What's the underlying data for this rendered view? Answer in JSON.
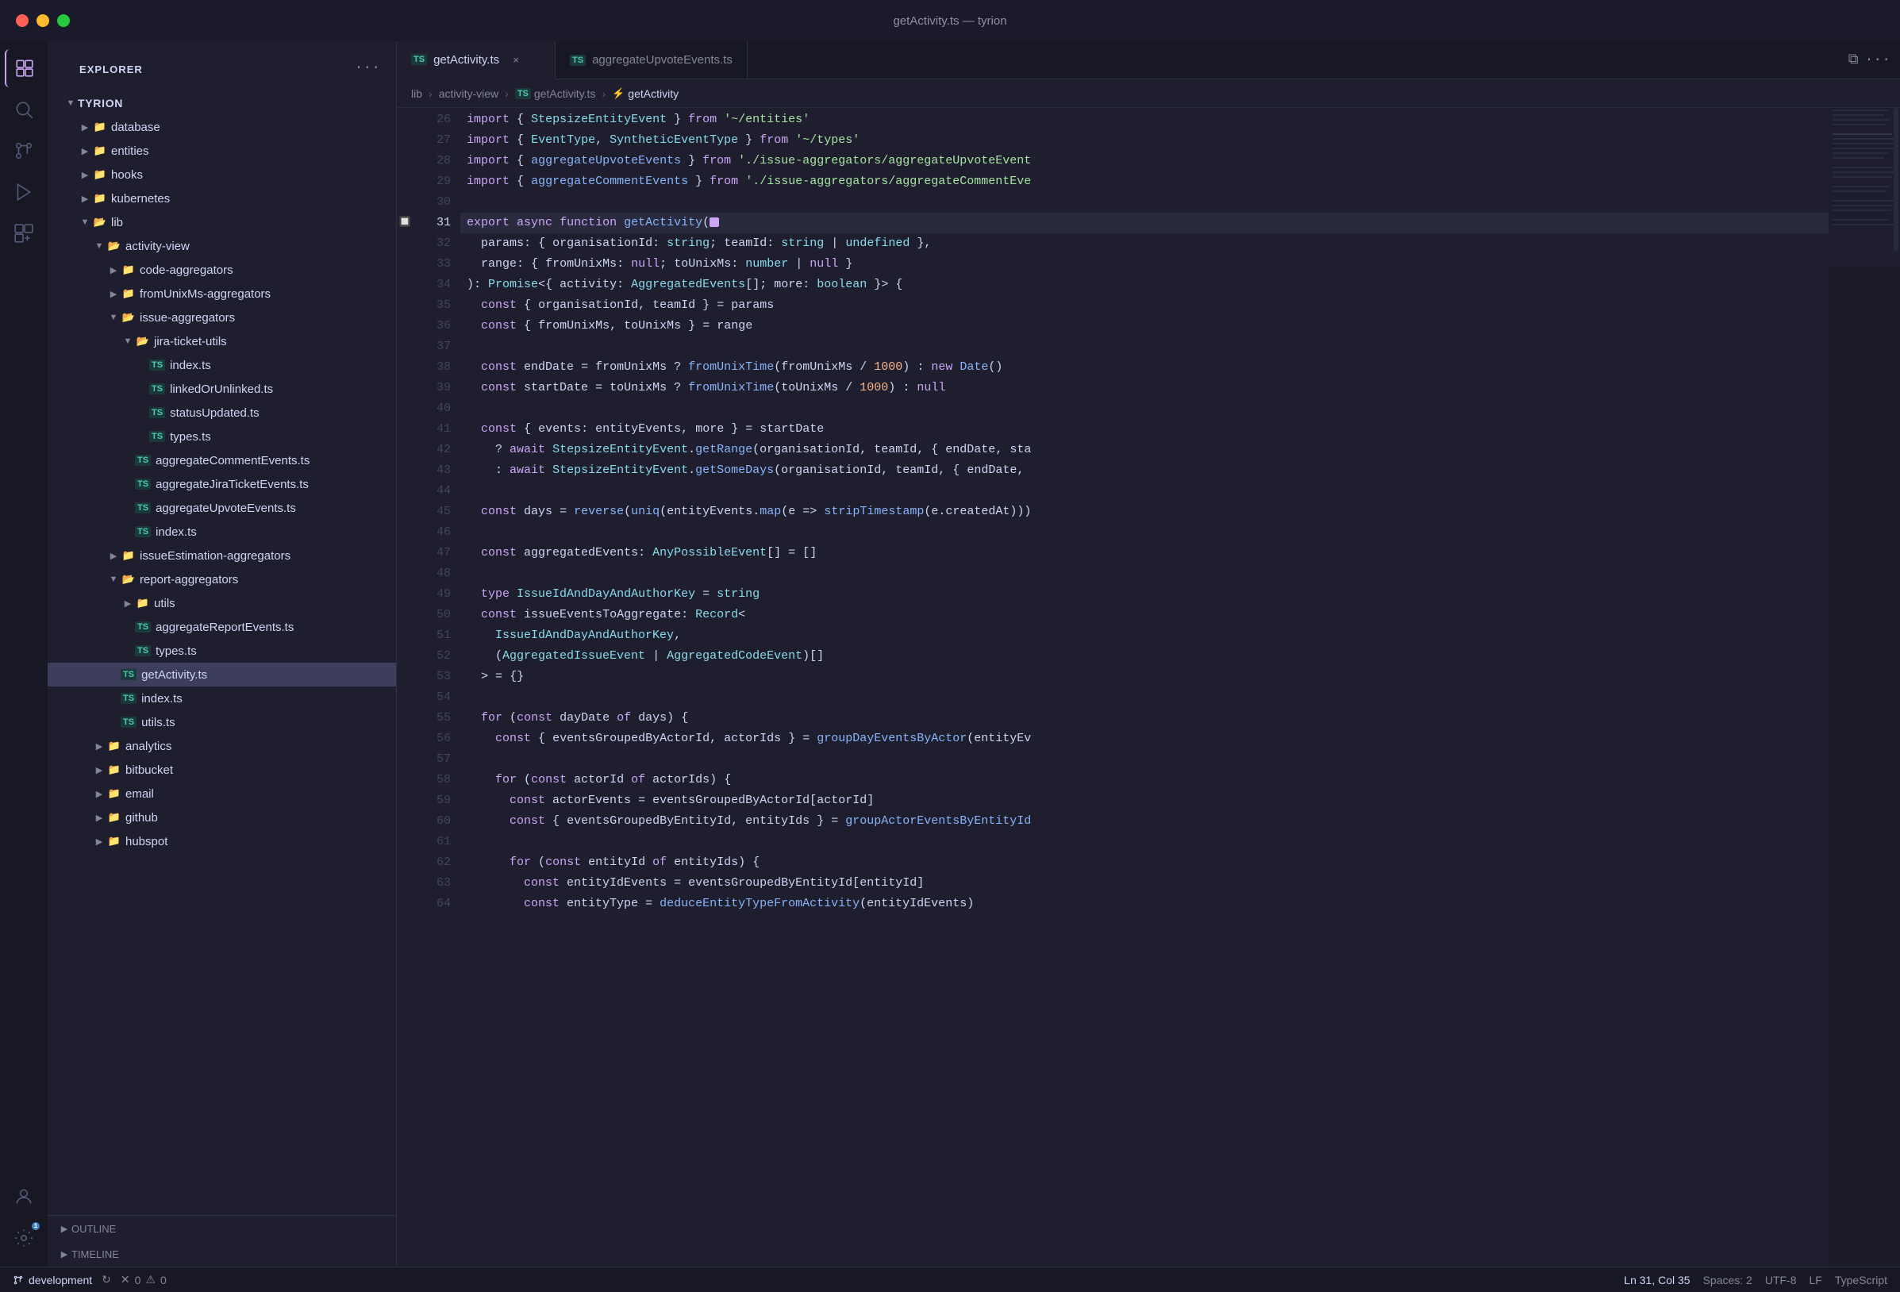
{
  "titlebar": {
    "title": "getActivity.ts — tyrion"
  },
  "tabs": [
    {
      "id": "getActivity",
      "label": "getActivity.ts",
      "icon": "TS",
      "active": true,
      "closeable": true
    },
    {
      "id": "aggregateUpvoteEvents",
      "label": "aggregateUpvoteEvents.ts",
      "icon": "TS",
      "active": false,
      "closeable": false
    }
  ],
  "breadcrumb": {
    "items": [
      "lib",
      "activity-view",
      "getActivity.ts",
      "getActivity"
    ]
  },
  "sidebar": {
    "header": "EXPLORER",
    "tree": [
      {
        "id": "tyrion",
        "label": "TYRION",
        "level": 0,
        "type": "root",
        "expanded": true
      },
      {
        "id": "database",
        "label": "database",
        "level": 1,
        "type": "folder",
        "expanded": false
      },
      {
        "id": "entities",
        "label": "entities",
        "level": 1,
        "type": "folder",
        "expanded": false
      },
      {
        "id": "hooks",
        "label": "hooks",
        "level": 1,
        "type": "folder",
        "expanded": false
      },
      {
        "id": "kubernetes",
        "label": "kubernetes",
        "level": 1,
        "type": "folder",
        "expanded": false
      },
      {
        "id": "lib",
        "label": "lib",
        "level": 1,
        "type": "folder",
        "expanded": true
      },
      {
        "id": "activity-view",
        "label": "activity-view",
        "level": 2,
        "type": "folder",
        "expanded": true
      },
      {
        "id": "code-aggregators",
        "label": "code-aggregators",
        "level": 3,
        "type": "folder",
        "expanded": false
      },
      {
        "id": "fromUnixMs-aggregators",
        "label": "fromUnixMs-aggregators",
        "level": 3,
        "type": "folder",
        "expanded": false
      },
      {
        "id": "issue-aggregators",
        "label": "issue-aggregators",
        "level": 3,
        "type": "folder",
        "expanded": true
      },
      {
        "id": "jira-ticket-utils",
        "label": "jira-ticket-utils",
        "level": 4,
        "type": "folder",
        "expanded": true
      },
      {
        "id": "index.ts-jira",
        "label": "index.ts",
        "level": 5,
        "type": "ts"
      },
      {
        "id": "linkedOrUnlinked.ts",
        "label": "linkedOrUnlinked.ts",
        "level": 5,
        "type": "ts"
      },
      {
        "id": "statusUpdated.ts",
        "label": "statusUpdated.ts",
        "level": 5,
        "type": "ts"
      },
      {
        "id": "types.ts-jira",
        "label": "types.ts",
        "level": 5,
        "type": "ts"
      },
      {
        "id": "aggregateCommentEvents.ts",
        "label": "aggregateCommentEvents.ts",
        "level": 4,
        "type": "ts"
      },
      {
        "id": "aggregateJiraTicketEvents.ts",
        "label": "aggregateJiraTicketEvents.ts",
        "level": 4,
        "type": "ts"
      },
      {
        "id": "aggregateUpvoteEvents.ts",
        "label": "aggregateUpvoteEvents.ts",
        "level": 4,
        "type": "ts"
      },
      {
        "id": "index.ts-issue",
        "label": "index.ts",
        "level": 4,
        "type": "ts"
      },
      {
        "id": "issueEstimation-aggregators",
        "label": "issueEstimation-aggregators",
        "level": 3,
        "type": "folder",
        "expanded": false
      },
      {
        "id": "report-aggregators",
        "label": "report-aggregators",
        "level": 3,
        "type": "folder",
        "expanded": true
      },
      {
        "id": "utils",
        "label": "utils",
        "level": 4,
        "type": "folder",
        "expanded": false
      },
      {
        "id": "aggregateReportEvents.ts",
        "label": "aggregateReportEvents.ts",
        "level": 4,
        "type": "ts"
      },
      {
        "id": "types.ts-report",
        "label": "types.ts",
        "level": 4,
        "type": "ts"
      },
      {
        "id": "getActivity.ts",
        "label": "getActivity.ts",
        "level": 3,
        "type": "ts",
        "selected": true
      },
      {
        "id": "index.ts-lib",
        "label": "index.ts",
        "level": 3,
        "type": "ts"
      },
      {
        "id": "utils.ts",
        "label": "utils.ts",
        "level": 3,
        "type": "ts"
      },
      {
        "id": "analytics",
        "label": "analytics",
        "level": 2,
        "type": "folder",
        "expanded": false
      },
      {
        "id": "bitbucket",
        "label": "bitbucket",
        "level": 2,
        "type": "folder",
        "expanded": false
      },
      {
        "id": "email",
        "label": "email",
        "level": 2,
        "type": "folder",
        "expanded": false
      },
      {
        "id": "github",
        "label": "github",
        "level": 2,
        "type": "folder",
        "expanded": false
      },
      {
        "id": "hubspot",
        "label": "hubspot",
        "level": 2,
        "type": "folder",
        "expanded": false
      }
    ]
  },
  "outline": {
    "label": "OUTLINE"
  },
  "timeline": {
    "label": "TIMELINE"
  },
  "code": {
    "lines": [
      {
        "num": 26,
        "content": "import { StepsizeEntityEvent } from '~/entities'"
      },
      {
        "num": 27,
        "content": "import { EventType, SyntheticEventType } from '~/types'"
      },
      {
        "num": 28,
        "content": "import { aggregateUpvoteEvents } from './issue-aggregators/aggregateUpvoteEvent"
      },
      {
        "num": 29,
        "content": "import { aggregateCommentEvents } from './issue-aggregators/aggregateCommentEve"
      },
      {
        "num": 30,
        "content": ""
      },
      {
        "num": 31,
        "content": "export async function getActivity(",
        "highlighted": true,
        "breakpoint": true
      },
      {
        "num": 32,
        "content": "  params: { organisationId: string; teamId: string | undefined },"
      },
      {
        "num": 33,
        "content": "  range: { fromUnixMs: null; toUnixMs: number | null }"
      },
      {
        "num": 34,
        "content": "): Promise<{ activity: AggregatedEvents[]; more: boolean }> {"
      },
      {
        "num": 35,
        "content": "  const { organisationId, teamId } = params"
      },
      {
        "num": 36,
        "content": "  const { fromUnixMs, toUnixMs } = range"
      },
      {
        "num": 37,
        "content": ""
      },
      {
        "num": 38,
        "content": "  const endDate = fromUnixMs ? fromUnixTime(fromUnixMs / 1000) : new Date()"
      },
      {
        "num": 39,
        "content": "  const startDate = toUnixMs ? fromUnixTime(toUnixMs / 1000) : null"
      },
      {
        "num": 40,
        "content": ""
      },
      {
        "num": 41,
        "content": "  const { events: entityEvents, more } = startDate"
      },
      {
        "num": 42,
        "content": "    ? await StepsizeEntityEvent.getRange(organisationId, teamId, { endDate, sta"
      },
      {
        "num": 43,
        "content": "    : await StepsizeEntityEvent.getSomeDays(organisationId, teamId, { endDate,"
      },
      {
        "num": 44,
        "content": ""
      },
      {
        "num": 45,
        "content": "  const days = reverse(uniq(entityEvents.map(e => stripTimestamp(e.createdAt)))"
      },
      {
        "num": 46,
        "content": ""
      },
      {
        "num": 47,
        "content": "  const aggregatedEvents: AnyPossibleEvent[] = []"
      },
      {
        "num": 48,
        "content": ""
      },
      {
        "num": 49,
        "content": "  type IssueIdAndDayAndAuthorKey = string"
      },
      {
        "num": 50,
        "content": "  const issueEventsToAggregate: Record<"
      },
      {
        "num": 51,
        "content": "    IssueIdAndDayAndAuthorKey,"
      },
      {
        "num": 52,
        "content": "    (AggregatedIssueEvent | AggregatedCodeEvent)[]"
      },
      {
        "num": 53,
        "content": "  > = {}"
      },
      {
        "num": 54,
        "content": ""
      },
      {
        "num": 55,
        "content": "  for (const dayDate of days) {"
      },
      {
        "num": 56,
        "content": "    const { eventsGroupedByActorId, actorIds } = groupDayEventsByActor(entityEv"
      },
      {
        "num": 57,
        "content": ""
      },
      {
        "num": 58,
        "content": "    for (const actorId of actorIds) {"
      },
      {
        "num": 59,
        "content": "      const actorEvents = eventsGroupedByActorId[actorId]"
      },
      {
        "num": 60,
        "content": "      const { eventsGroupedByEntityId, entityIds } = groupActorEventsByEntityId"
      },
      {
        "num": 61,
        "content": ""
      },
      {
        "num": 62,
        "content": "      for (const entityId of entityIds) {"
      },
      {
        "num": 63,
        "content": "        const entityIdEvents = eventsGroupedByEntityId[entityId]"
      },
      {
        "num": 64,
        "content": "        const entityType = deduceEntityTypeFromActivity(entityIdEvents)"
      }
    ]
  },
  "statusbar": {
    "branch": "development",
    "sync_icon": "↻",
    "errors": "0",
    "warnings": "0",
    "cursor": "Ln 31, Col 35",
    "spaces": "Spaces: 2",
    "encoding": "UTF-8",
    "line_ending": "LF",
    "language": "TypeScript"
  },
  "icons": {
    "explorer": "⬚",
    "search": "⌕",
    "source_control": "⑂",
    "run": "▷",
    "extensions": "⊞",
    "settings": "⚙",
    "account": "◯",
    "branch": "⎇",
    "error": "✕",
    "warning": "⚠"
  }
}
